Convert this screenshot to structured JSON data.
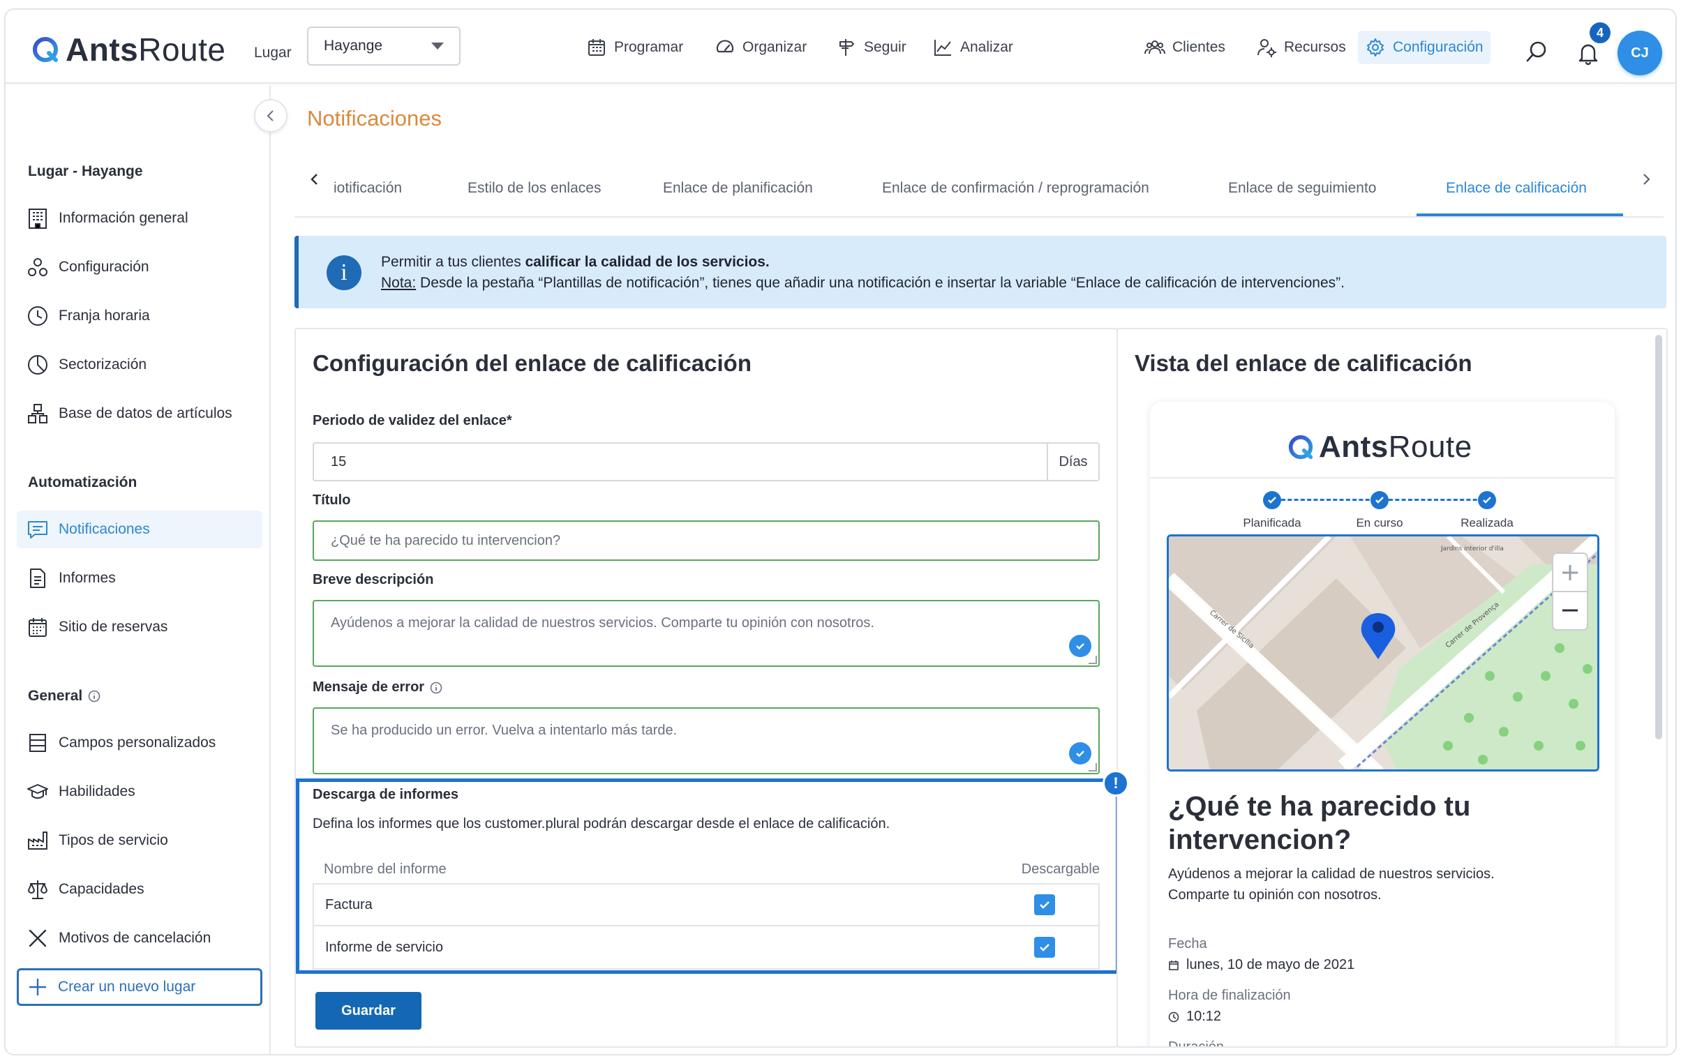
{
  "app": {
    "logo_text_bold": "Ants",
    "logo_text_rest": "Route"
  },
  "header": {
    "place_label": "Lugar",
    "place_value": "Hayange",
    "nav": [
      {
        "label": "Programar",
        "icon": "calendar-icon"
      },
      {
        "label": "Organizar",
        "icon": "speedometer-icon"
      },
      {
        "label": "Seguir",
        "icon": "signpost-icon"
      },
      {
        "label": "Analizar",
        "icon": "chart-icon"
      },
      {
        "label": "Clientes",
        "icon": "users-icon"
      },
      {
        "label": "Recursos",
        "icon": "user-gear-icon"
      },
      {
        "label": "Configuración",
        "icon": "gear-icon"
      }
    ],
    "notifications_count": "4",
    "avatar_initials": "CJ",
    "colors": {
      "accent": "#2c86d4",
      "avatar": "#2f8ee5",
      "badge": "#1565c0"
    }
  },
  "sidebar": {
    "section_place": "Lugar - Hayange",
    "place_items": [
      {
        "label": "Información general",
        "icon": "building-icon"
      },
      {
        "label": "Configuración",
        "icon": "config-icon"
      },
      {
        "label": "Franja horaria",
        "icon": "clock-icon"
      },
      {
        "label": "Sectorización",
        "icon": "pie-icon"
      },
      {
        "label": "Base de datos de artículos",
        "icon": "boxes-icon"
      }
    ],
    "section_automation": "Automatización",
    "automation_items": [
      {
        "label": "Notificaciones",
        "icon": "message-icon",
        "active": true
      },
      {
        "label": "Informes",
        "icon": "document-icon"
      },
      {
        "label": "Sitio de reservas",
        "icon": "calendar-grid-icon"
      }
    ],
    "section_general": "General",
    "general_items": [
      {
        "label": "Campos personalizados",
        "icon": "list-icon"
      },
      {
        "label": "Habilidades",
        "icon": "graduation-icon"
      },
      {
        "label": "Tipos de servicio",
        "icon": "factory-icon"
      },
      {
        "label": "Capacidades",
        "icon": "scale-icon"
      },
      {
        "label": "Motivos de cancelación",
        "icon": "x-icon"
      }
    ],
    "new_place": "Crear un nuevo lugar"
  },
  "main": {
    "page_title": "Notificaciones",
    "tabs": [
      {
        "label": "iotificación"
      },
      {
        "label": "Estilo de los enlaces"
      },
      {
        "label": "Enlace de planificación"
      },
      {
        "label": "Enlace de confirmación / reprogramación"
      },
      {
        "label": "Enlace de seguimiento"
      },
      {
        "label": "Enlace de calificación",
        "active": true
      }
    ],
    "banner": {
      "line1_prefix": "Permitir a tus clientes ",
      "line1_bold": "calificar la calidad de los servicios.",
      "note_label": "Nota:",
      "line2": " Desde la pestaña “Plantillas de notificación”, tienes que añadir una notificación e insertar la variable “Enlace de calificación de intervenciones”."
    },
    "form": {
      "title": "Configuración del enlace de calificación",
      "validity_label": "Periodo de validez del enlace*",
      "validity_value": "15",
      "validity_unit": "Días",
      "title_label": "Título",
      "title_placeholder": "¿Qué te ha parecido tu intervencion?",
      "short_desc_label": "Breve descripción",
      "short_desc_value": "Ayúdenos a mejorar la calidad de nuestros servicios. Comparte tu opinión con nosotros.",
      "error_label": "Mensaje de error",
      "error_value": "Se ha producido un error. Vuelva a intentarlo más tarde.",
      "reports_label": "Descarga de informes",
      "reports_desc": "Defina los informes que los customer.plural podrán descargar desde el enlace de calificación.",
      "reports_col_name": "Nombre del informe",
      "reports_col_download": "Descargable",
      "reports": [
        {
          "name": "Factura",
          "downloadable": true
        },
        {
          "name": "Informe de servicio",
          "downloadable": true
        }
      ],
      "save": "Guardar"
    },
    "preview": {
      "title": "Vista del enlace de calificación",
      "steps": [
        "Planificada",
        "En curso",
        "Realizada"
      ],
      "map_labels": [
        "Carrer de Sicília",
        "Carrer de Provença",
        "Jardins interior d'illa"
      ],
      "question": "¿Qué te ha parecido tu intervencion?",
      "description": "Ayúdenos a mejorar la calidad de nuestros servicios. Comparte tu opinión con nosotros.",
      "date_label": "Fecha",
      "date_value": "lunes, 10 de mayo de 2021",
      "end_label": "Hora de finalización",
      "end_value": "10:12",
      "duration_label": "Duración"
    }
  }
}
